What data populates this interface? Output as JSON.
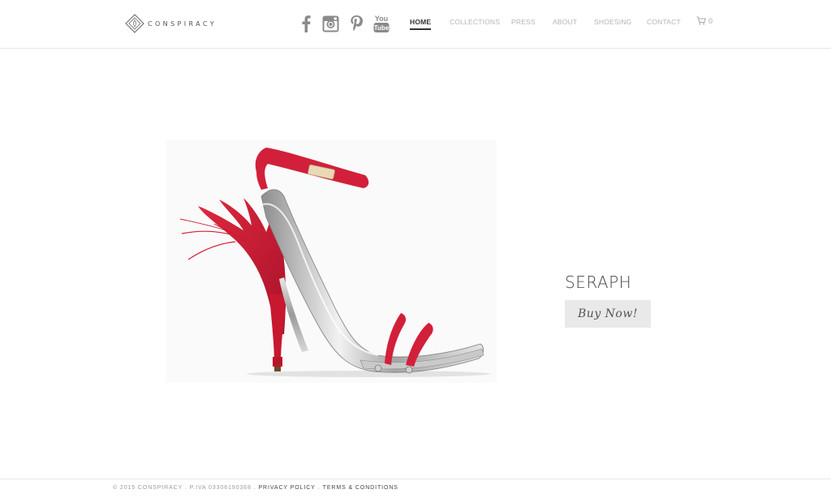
{
  "brand": {
    "name": "CONSPIRACY"
  },
  "social": [
    {
      "icon": "facebook-icon"
    },
    {
      "icon": "instagram-icon"
    },
    {
      "icon": "pinterest-icon"
    },
    {
      "icon": "youtube-icon",
      "text": "You Tube"
    }
  ],
  "nav": {
    "items": [
      {
        "label": "HOME",
        "active": true
      },
      {
        "label": "COLLECTIONS"
      },
      {
        "label": "PRESS"
      },
      {
        "label": "ABOUT"
      },
      {
        "label": "SHOESING"
      },
      {
        "label": "CONTACT"
      }
    ],
    "cart_count": "0"
  },
  "product": {
    "name": "SERAPH",
    "buy_label": "Buy Now!"
  },
  "footer": {
    "copyright": "© 2015 CONSPIRACY . P.IVA 03306190368 .",
    "privacy": "PRIVACY POLICY",
    "separator": ".",
    "terms": "TERMS & CONDITIONS"
  },
  "colors": {
    "accent_red": "#d2203a",
    "metal": "#b8b8b8",
    "text": "#333333",
    "nav_inactive": "#b5b5b5"
  }
}
